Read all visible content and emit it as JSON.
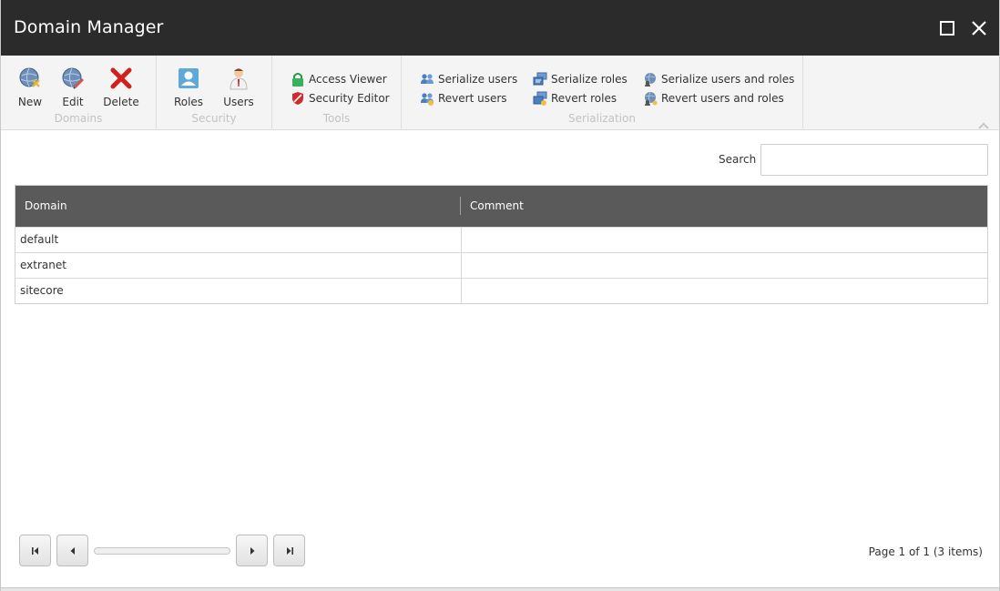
{
  "window": {
    "title": "Domain Manager",
    "maximize_icon": "maximize-icon",
    "close_icon": "close-icon"
  },
  "ribbon": {
    "groups": [
      {
        "label": "Domains",
        "buttons": [
          {
            "label": "New",
            "icon": "globe-new-icon"
          },
          {
            "label": "Edit",
            "icon": "globe-edit-icon"
          },
          {
            "label": "Delete",
            "icon": "delete-x-icon"
          }
        ]
      },
      {
        "label": "Security",
        "buttons": [
          {
            "label": "Roles",
            "icon": "role-card-icon"
          },
          {
            "label": "Users",
            "icon": "user-icon"
          }
        ]
      },
      {
        "label": "Tools",
        "buttons": [
          {
            "label": "Access Viewer",
            "icon": "lock-icon"
          },
          {
            "label": "Security Editor",
            "icon": "shield-icon"
          }
        ]
      },
      {
        "label": "Serialization",
        "buttons": [
          {
            "label": "Serialize users",
            "icon": "users-icon"
          },
          {
            "label": "Revert users",
            "icon": "users-revert-icon"
          },
          {
            "label": "Serialize roles",
            "icon": "roles-icon"
          },
          {
            "label": "Revert roles",
            "icon": "roles-revert-icon"
          },
          {
            "label": "Serialize users and roles",
            "icon": "globe-users-icon"
          },
          {
            "label": "Revert users and roles",
            "icon": "globe-users-revert-icon"
          }
        ]
      }
    ]
  },
  "search": {
    "label": "Search",
    "value": "",
    "placeholder": ""
  },
  "table": {
    "columns": [
      "Domain",
      "Comment"
    ],
    "rows": [
      [
        "default",
        ""
      ],
      [
        "extranet",
        ""
      ],
      [
        "sitecore",
        ""
      ]
    ]
  },
  "pager": {
    "info": "Page 1 of 1 (3 items)",
    "buttons": [
      "first-page-icon",
      "prev-page-icon",
      "next-page-icon",
      "last-page-icon"
    ]
  },
  "colors": {
    "titlebar": "#2b2b2b",
    "grid_header": "#5a5a5a",
    "ribbon": "#f4f4f4"
  }
}
